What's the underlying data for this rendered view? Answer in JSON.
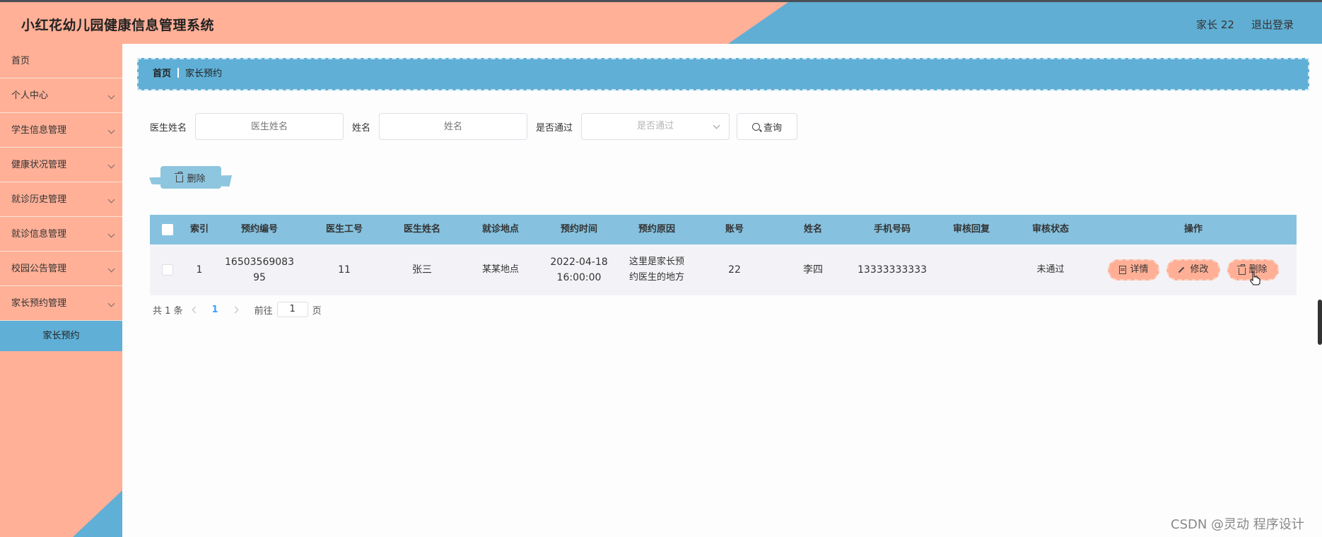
{
  "header": {
    "title": "小红花幼儿园健康信息管理系统",
    "user": "家长 22",
    "logout": "退出登录"
  },
  "sidebar": {
    "items": [
      {
        "label": "首页"
      },
      {
        "label": "个人中心"
      },
      {
        "label": "学生信息管理"
      },
      {
        "label": "健康状况管理"
      },
      {
        "label": "就诊历史管理"
      },
      {
        "label": "就诊信息管理"
      },
      {
        "label": "校园公告管理"
      },
      {
        "label": "家长预约管理"
      }
    ],
    "active_sub": "家长预约"
  },
  "breadcrumb": {
    "home": "首页",
    "current": "家长预约"
  },
  "search": {
    "doctor_name_label": "医生姓名",
    "doctor_name_placeholder": "医生姓名",
    "name_label": "姓名",
    "name_placeholder": "姓名",
    "passed_label": "是否通过",
    "passed_placeholder": "是否通过",
    "query_button": "查询"
  },
  "actions": {
    "delete_button": "删除"
  },
  "table": {
    "headers": [
      "索引",
      "预约编号",
      "医生工号",
      "医生姓名",
      "就诊地点",
      "预约时间",
      "预约原因",
      "账号",
      "姓名",
      "手机号码",
      "审核回复",
      "审核状态",
      "操作"
    ],
    "rows": [
      {
        "index": "1",
        "booking_no": "1650356908395",
        "doctor_id": "11",
        "doctor_name": "张三",
        "location": "某某地点",
        "time": "2022-04-18 16:00:00",
        "reason": "这里是家长预约医生的地方",
        "account": "22",
        "name": "李四",
        "phone": "13333333333",
        "reply": "",
        "status": "未通过"
      }
    ],
    "op_labels": {
      "detail": "详情",
      "edit": "修改",
      "delete": "删除"
    }
  },
  "pager": {
    "total": "共 1 条",
    "current_page": "1",
    "goto_label": "前往",
    "goto_value": "1",
    "page_unit": "页"
  },
  "watermark": "CSDN @灵动 程序设计",
  "colors": {
    "salmon": "#ffb097",
    "blue": "#5fafd6",
    "header_row": "#86c2df"
  }
}
